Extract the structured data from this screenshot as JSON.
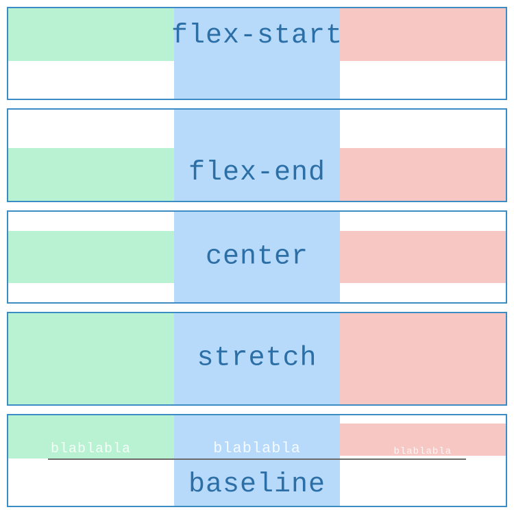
{
  "rows": [
    {
      "label": "flex-start"
    },
    {
      "label": "flex-end"
    },
    {
      "label": "center"
    },
    {
      "label": "stretch"
    },
    {
      "label": "baseline",
      "bla": "blablabla"
    }
  ],
  "colors": {
    "border": "#3b8bc4",
    "text": "#2c6fa6",
    "green": "#b8f2d2",
    "blue": "#b7dafb",
    "pink": "#f7c7c3"
  }
}
